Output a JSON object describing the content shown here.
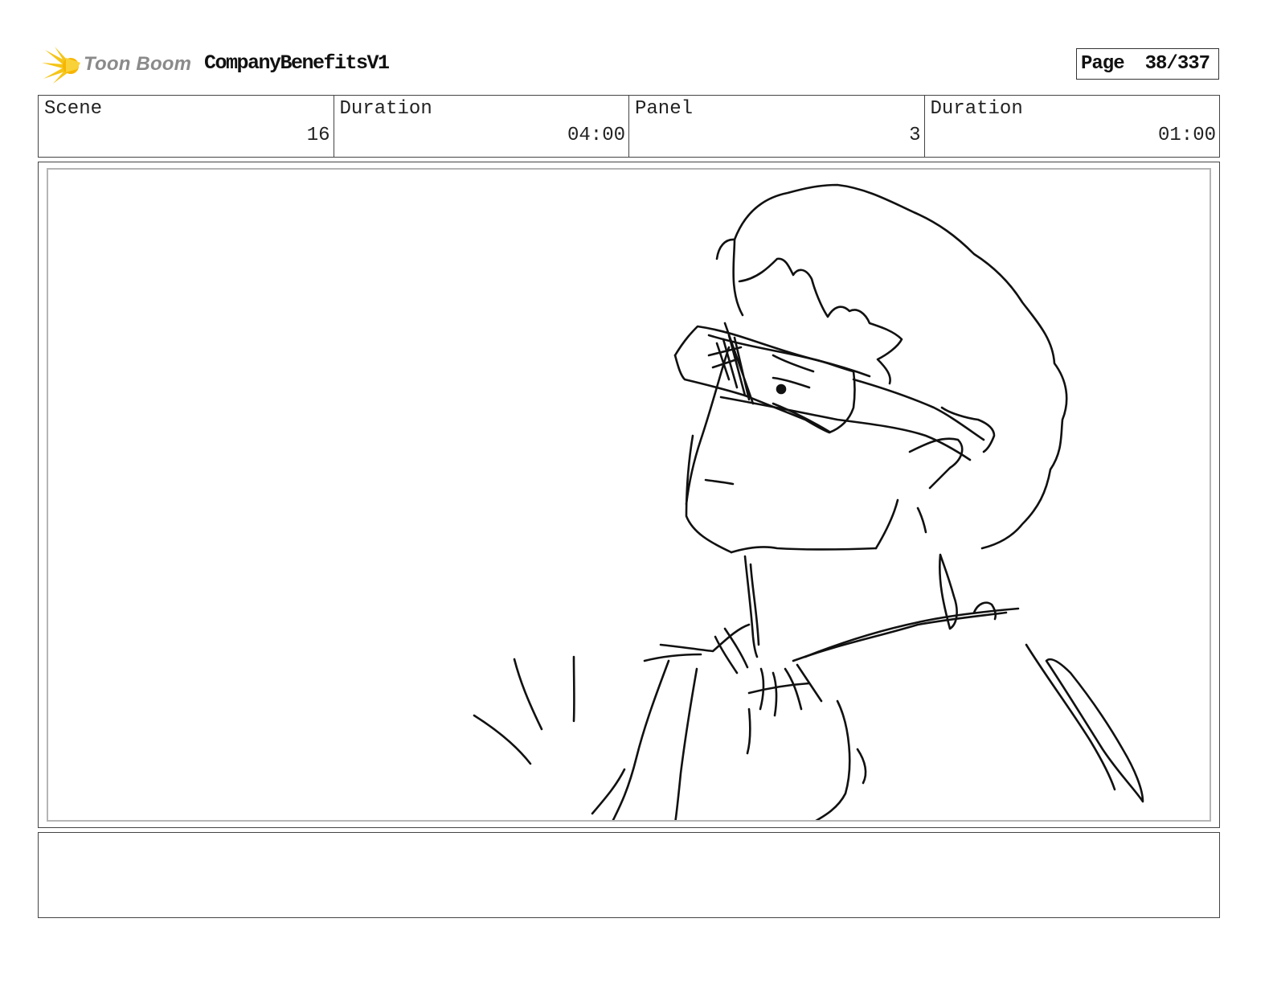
{
  "header": {
    "logo_text": "Toon Boom",
    "project_title": "CompanyBenefitsV1",
    "page_label": "Page",
    "page_number": "38/337"
  },
  "info": {
    "scene_label": "Scene",
    "scene_value": "16",
    "scene_duration_label": "Duration",
    "scene_duration_value": "04:00",
    "panel_label": "Panel",
    "panel_value": "3",
    "panel_duration_label": "Duration",
    "panel_duration_value": "01:00"
  },
  "notes": {
    "text": ""
  }
}
